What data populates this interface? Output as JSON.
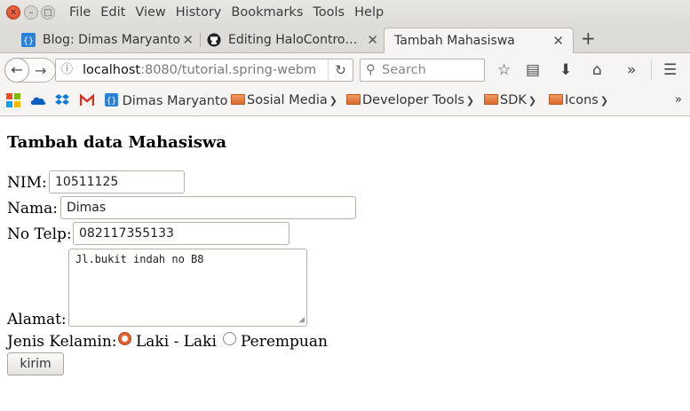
{
  "menu": [
    "File",
    "Edit",
    "View",
    "History",
    "Bookmarks",
    "Tools",
    "Help"
  ],
  "tabs": [
    {
      "title": "Blog: Dimas Maryanto",
      "icon": "brackets-icon"
    },
    {
      "title": "Editing HaloContro…",
      "icon": "github-icon"
    },
    {
      "title": "Tambah Mahasiswa",
      "active": true
    }
  ],
  "nav": {
    "url_host": "localhost",
    "url_rest": ":8080/tutorial.spring-webm",
    "search_placeholder": "Search"
  },
  "bookmarks": [
    {
      "label": "Dimas Maryanto",
      "icon": "brackets-icon"
    },
    {
      "label": "Sosial Media",
      "folder": true
    },
    {
      "label": "Developer Tools",
      "folder": true
    },
    {
      "label": "SDK",
      "folder": true
    },
    {
      "label": "Icons",
      "folder": true
    }
  ],
  "form": {
    "heading": "Tambah data Mahasiswa",
    "nim_label": "NIM:",
    "nim_value": "10511125",
    "nama_label": "Nama:",
    "nama_value": "Dimas",
    "telp_label": "No Telp:",
    "telp_value": "082117355133",
    "alamat_label": "Alamat:",
    "alamat_value": "Jl.bukit indah no B8",
    "gender_label": "Jenis Kelamin:",
    "gender_options": [
      "Laki - Laki",
      "Perempuan"
    ],
    "gender_selected": "Laki - Laki",
    "submit_label": "kirim"
  },
  "colors": {
    "close_button": "#e0552e",
    "radio_checked": "#e2622f",
    "chrome_bg": "#dedcd8"
  }
}
